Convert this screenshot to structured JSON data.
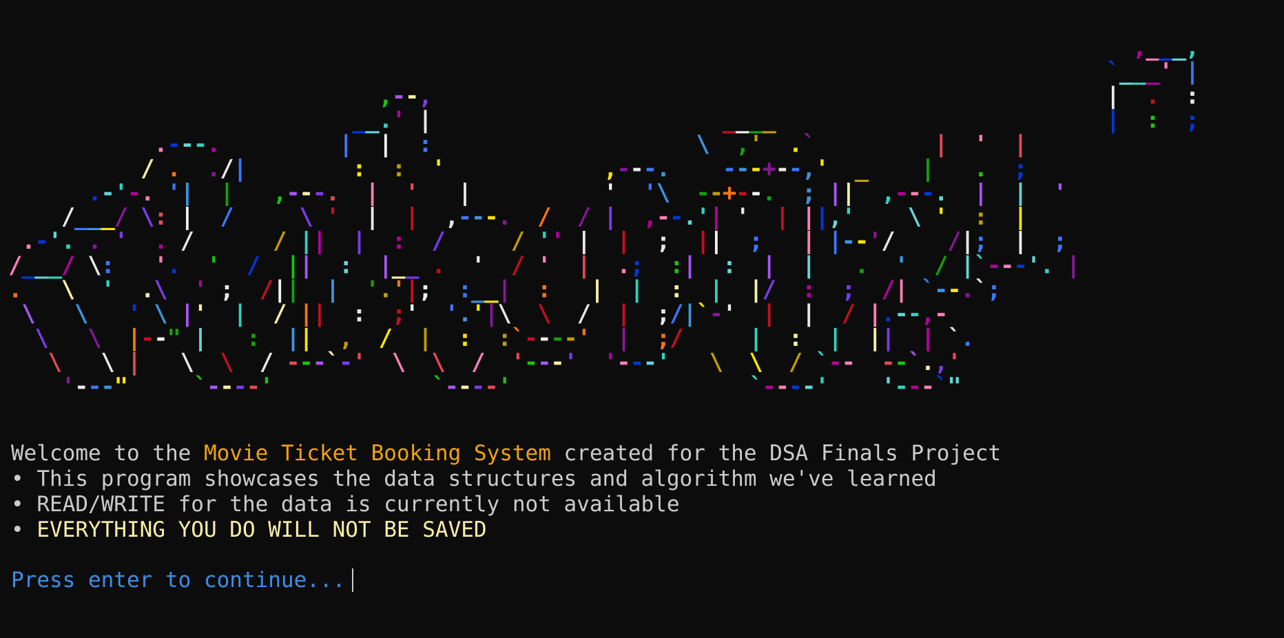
{
  "banner": {
    "rows": [
      "                                                                                     ,___,",
      "                                                                                   `___' |",
      "                            ,--,                                                   |  .  :",
      "                          __.' |                      ____                         |  :  ;",
      "           .---.         |  |  :                    \\  ,'  .`         |  '  |",
      "          / .  ./|        :  :  '            ,---.    ---+--,'  _    |   .  ;",
      "      .-'-. '|  |   ,---.  |  '   |          '  '\\  --+--.  ; ||  ,---.  |  |  '",
      "    /___/ \\: |  /     \\ '  |  |  ,---.  /  / |  ,--.'| '  | ||,'    \\ '  :  |",
      " .-'. . '  . /      / ||  |  :  /     / '' |  |  ;  ||  ;   | |--'/    /|;  |  ;",
      "/___/ \\:   '.  '  /  ||  :  |__ .  '  / '  |  .;  :|  :  |  |   .  '  / |`---'. |",
      ".   \\  '  .\\  ' ;  /||  |  '.'|;  :__|  :   |  |  :  |  |/  :  ;  /| `--.`;",
      " \\   \\   ' \\ |'  |  / ||  :  ;'  '.'|\\  \\  /  |  ;/|`-'  |  |  / |.--,-",
      "  \\   \\  |--\" |   :  ||  ,  /  |  :  :`----'  |  ;/     |  :  |  ||  | `.",
      "   \\   \\ |   \\  \\  / ---`-'  \\  \\  /  '---'  '---'   \\  \\  / `--  --`.,'",
      "    '---\"     `----'            `----'                  `----'    '---`\""
    ]
  },
  "welcome": {
    "prefix": "Welcome to the ",
    "highlight": "Movie Ticket Booking System",
    "suffix": " created for the DSA Finals Project"
  },
  "bullets": [
    "• This program showcases the data structures and algorithm we've learned",
    "• READ/WRITE for the data is currently not available",
    "• "
  ],
  "warning": "EVERYTHING YOU DO WILL NOT BE SAVED",
  "prompt": "Press enter to continue...",
  "colors": {
    "background": "#0c0c0c",
    "text": "#cccccc",
    "highlight": "#f0a30a",
    "warning": "#f9f1a5",
    "prompt": "#3b8eea",
    "palette": [
      "#13a10e",
      "#0037da",
      "#3b78ff",
      "#e74856",
      "#c50f1f",
      "#b4009e",
      "#881798",
      "#f9f1a5",
      "#c19c00",
      "#61d6d6",
      "#3a96dd",
      "#16c60c",
      "#f2f2f2",
      "#ff7eb6",
      "#e8e8e8",
      "#7c3aed",
      "#f97316",
      "#2dd4bf",
      "#ffe600",
      "#a855f7"
    ]
  }
}
